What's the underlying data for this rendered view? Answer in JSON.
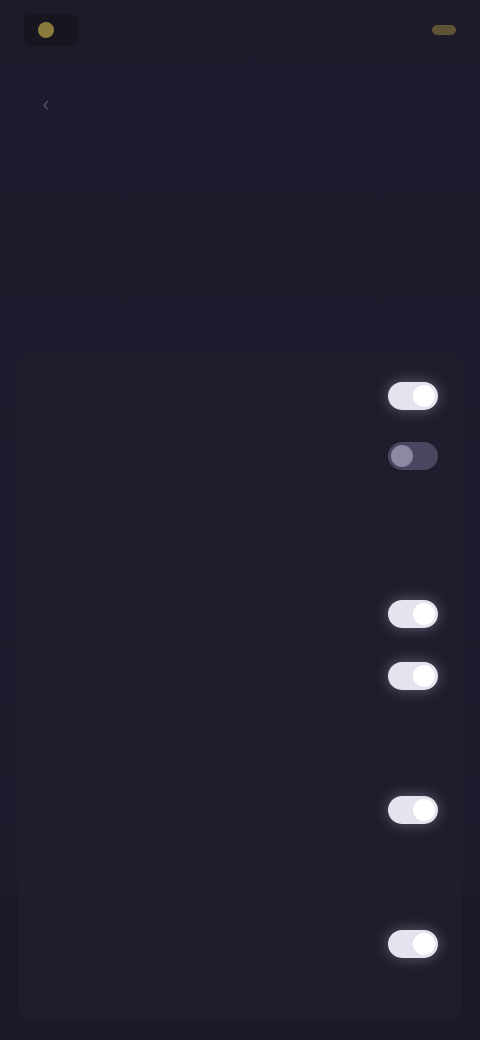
{
  "header": {
    "brand_name": "",
    "action_text": "",
    "action_button": ""
  },
  "page": {
    "title": "",
    "description": ""
  },
  "settings": {
    "row1": {
      "label": "",
      "state": "on"
    },
    "row2": {
      "label": "",
      "state": "off"
    },
    "help1": "",
    "section": "",
    "row3": {
      "label": "",
      "state": "on"
    },
    "row4": {
      "label": "",
      "state": "on"
    },
    "help2": "",
    "row5": {
      "label": "",
      "state": "on"
    },
    "help3": "",
    "row6": {
      "label": "",
      "state": "on"
    },
    "help4": ""
  },
  "colors": {
    "background": "#1d1a2b",
    "card": "#1f1c2d",
    "toggle_on": "#e6e3ef",
    "accent": "#5e5334"
  }
}
